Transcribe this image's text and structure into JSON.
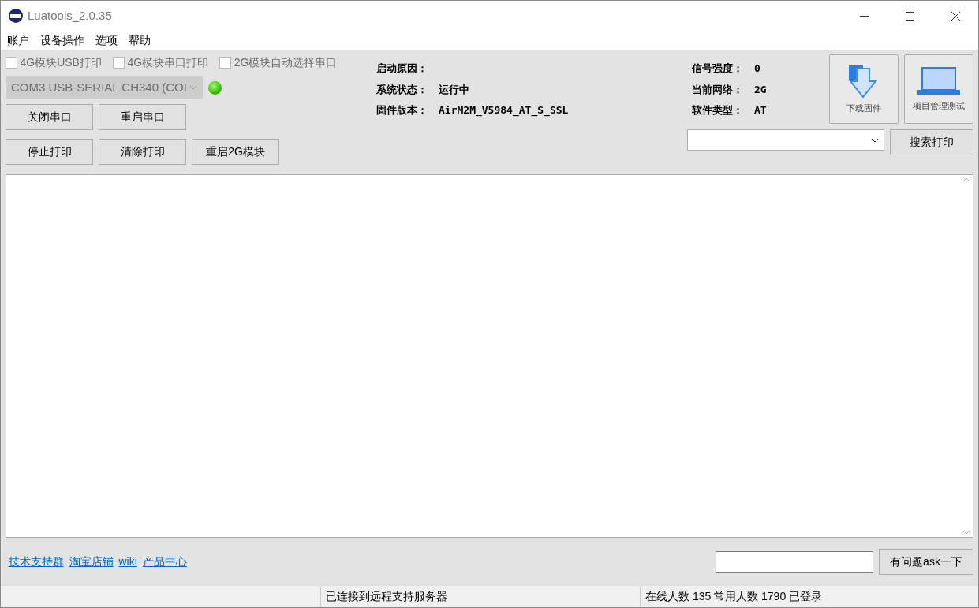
{
  "window": {
    "title": "Luatools_2.0.35"
  },
  "menu": [
    "账户",
    "设备操作",
    "选项",
    "帮助"
  ],
  "options": [
    {
      "label": "4G模块USB打印",
      "checked": false
    },
    {
      "label": "4G模块串口打印",
      "checked": false
    },
    {
      "label": "2G模块自动选择串口",
      "checked": false
    }
  ],
  "port": {
    "value": "COM3 USB-SERIAL CH340 (COI",
    "disabled": true,
    "connected": true
  },
  "port_buttons": [
    "关闭串口",
    "重启串口"
  ],
  "print_buttons": [
    "停止打印",
    "清除打印",
    "重启2G模块"
  ],
  "status_left": [
    {
      "label": "启动原因："
    },
    {
      "label": "系统状态：",
      "value": "运行中"
    },
    {
      "label": "固件版本：",
      "value": "AirM2M_V5984_AT_S_SSL"
    }
  ],
  "status_right": [
    {
      "label": "信号强度：",
      "value": "0"
    },
    {
      "label": "当前网络：",
      "value": "2G"
    },
    {
      "label": "软件类型：",
      "value": "AT"
    }
  ],
  "tool_buttons": [
    {
      "kind": "download",
      "label": "下载固件"
    },
    {
      "kind": "project",
      "label": "项目管理测试"
    }
  ],
  "search_button": "搜索打印",
  "links": [
    "技术支持群",
    "淘宝店铺",
    "wiki",
    "产品中心"
  ],
  "ask_button": "有问题ask一下",
  "status_bar": [
    "已连接到远程支持服务器",
    "在线人数 135 常用人数 1790 已登录"
  ]
}
